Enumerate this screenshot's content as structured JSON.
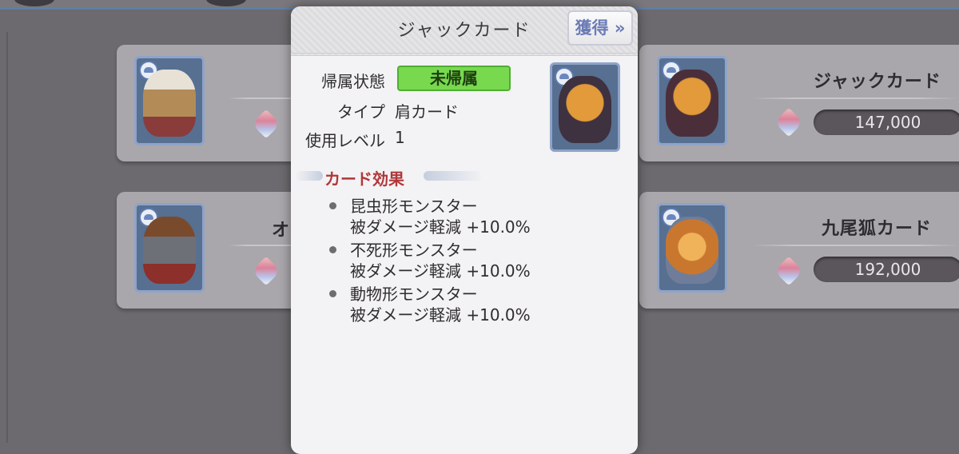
{
  "popup": {
    "title": "ジャックカード",
    "acquire_label": "獲得 »",
    "rows": [
      {
        "label": "帰属状態",
        "value": "未帰属"
      },
      {
        "label": "タイプ",
        "value": "肩カード"
      },
      {
        "label": "使用レベル",
        "value": "1"
      }
    ],
    "effect_heading": "カード効果",
    "effects": [
      {
        "target": "昆虫形モンスター",
        "desc": "被ダメージ軽減 +10.0%"
      },
      {
        "target": "不死形モンスター",
        "desc": "被ダメージ軽減 +10.0%"
      },
      {
        "target": "動物形モンスター",
        "desc": "被ダメージ軽減 +10.0%"
      }
    ]
  },
  "list": {
    "left_cards": [
      {
        "name": "",
        "price": ""
      },
      {
        "name": "オ",
        "price": ""
      }
    ],
    "right_cards": [
      {
        "name": "ジャックカード",
        "price": "147,000"
      },
      {
        "name": "九尾狐カード",
        "price": "192,000"
      }
    ]
  },
  "colors": {
    "status_green": "#78d94f",
    "effect_heading_red": "#b0373a",
    "frame_blue": "#8ea3c9"
  }
}
